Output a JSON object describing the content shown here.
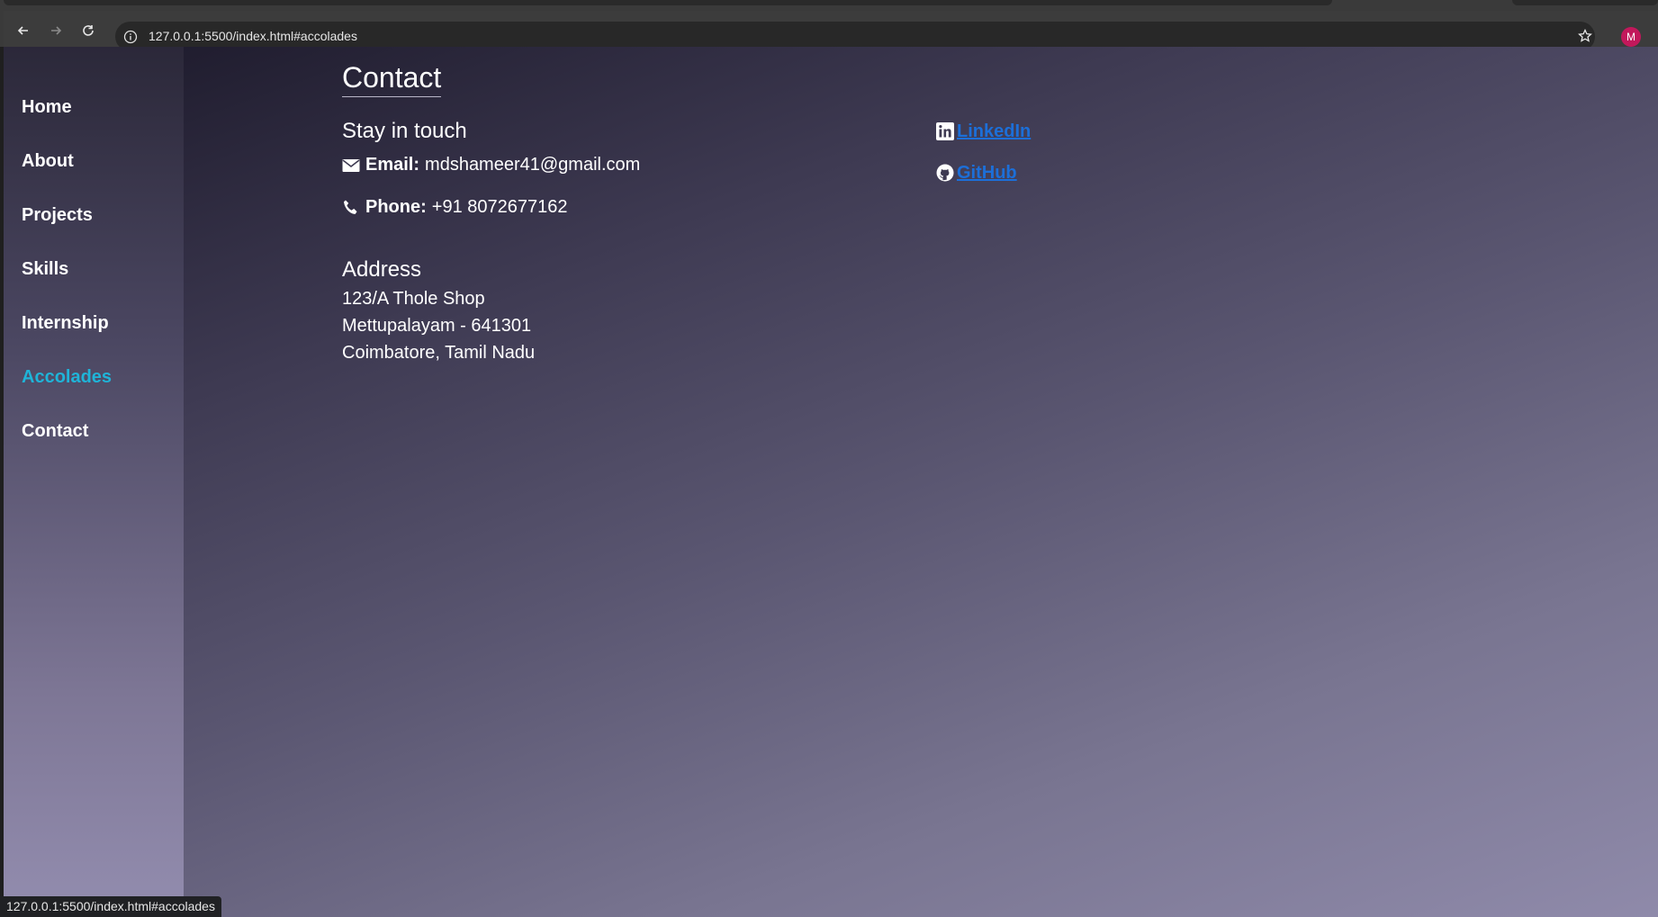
{
  "browser": {
    "url": "127.0.0.1:5500/index.html#accolades",
    "profile_initial": "M",
    "status_url": "127.0.0.1:5500/index.html#accolades",
    "profile_color": "#c2185b"
  },
  "sidebar": {
    "items": [
      {
        "label": "Home"
      },
      {
        "label": "About"
      },
      {
        "label": "Projects"
      },
      {
        "label": "Skills"
      },
      {
        "label": "Internship"
      },
      {
        "label": "Accolades"
      },
      {
        "label": "Contact"
      }
    ],
    "active_index": 5,
    "active_color": "#1fb4d8"
  },
  "contact": {
    "title": "Contact",
    "subtitle": "Stay in touch",
    "email_label": "Email:",
    "email_value": "mdshameer41@gmail.com",
    "phone_label": "Phone:",
    "phone_value": "+91 8072677162",
    "address_title": "Address",
    "address_lines": [
      "123/A Thole Shop",
      "Mettupalayam - 641301",
      "Coimbatore, Tamil Nadu"
    ]
  },
  "social": {
    "linkedin_label": "LinkedIn",
    "github_label": "GitHub",
    "link_color": "#1c6fd9"
  }
}
